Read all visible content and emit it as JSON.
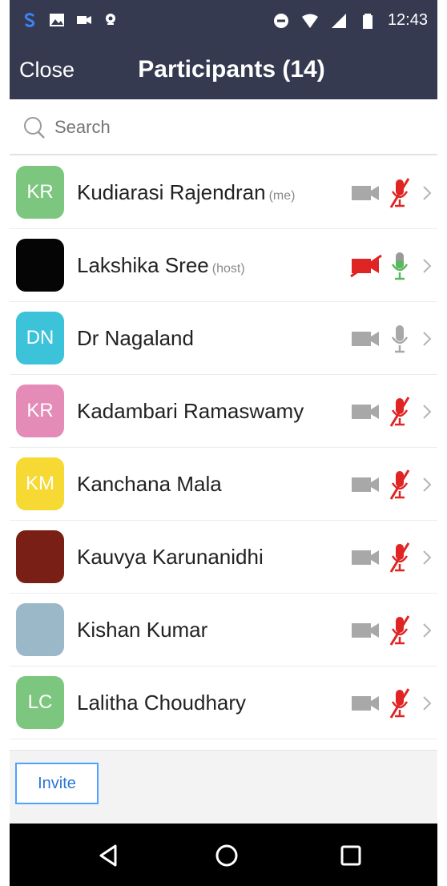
{
  "status_bar": {
    "time": "12:43"
  },
  "header": {
    "close_label": "Close",
    "title": "Participants (14)"
  },
  "search": {
    "placeholder": "Search"
  },
  "participants": [
    {
      "initials": "KR",
      "avatar_color": "#7dc67f",
      "name": "Kudiarasi Rajendran",
      "tag": "(me)",
      "video": "off",
      "mic": "muted"
    },
    {
      "initials": "",
      "avatar_color": "#050505",
      "name": "Lakshika Sree",
      "tag": "(host)",
      "video": "off-red",
      "mic": "on"
    },
    {
      "initials": "DN",
      "avatar_color": "#3cc3d9",
      "name": "Dr Nagaland",
      "tag": "",
      "video": "off",
      "mic": "gray"
    },
    {
      "initials": "KR",
      "avatar_color": "#e58bb8",
      "name": "Kadambari Ramaswamy",
      "tag": "",
      "video": "off",
      "mic": "muted"
    },
    {
      "initials": "KM",
      "avatar_color": "#f7d933",
      "name": "Kanchana Mala",
      "tag": "",
      "video": "off",
      "mic": "muted"
    },
    {
      "initials": "",
      "avatar_color": "#7a1f15",
      "name": "Kauvya Karunanidhi",
      "tag": "",
      "video": "off",
      "mic": "muted"
    },
    {
      "initials": "",
      "avatar_color": "#9bb8c9",
      "name": "Kishan Kumar",
      "tag": "",
      "video": "off",
      "mic": "muted"
    },
    {
      "initials": "LC",
      "avatar_color": "#7dc67f",
      "name": "Lalitha Choudhary",
      "tag": "",
      "video": "off",
      "mic": "muted"
    }
  ],
  "footer": {
    "invite_label": "Invite"
  },
  "colors": {
    "header_bg": "#353a50",
    "muted_red": "#e02424",
    "mic_green": "#57b85c",
    "icon_gray": "#a8a8a8",
    "invite_blue": "#2e75d6"
  }
}
